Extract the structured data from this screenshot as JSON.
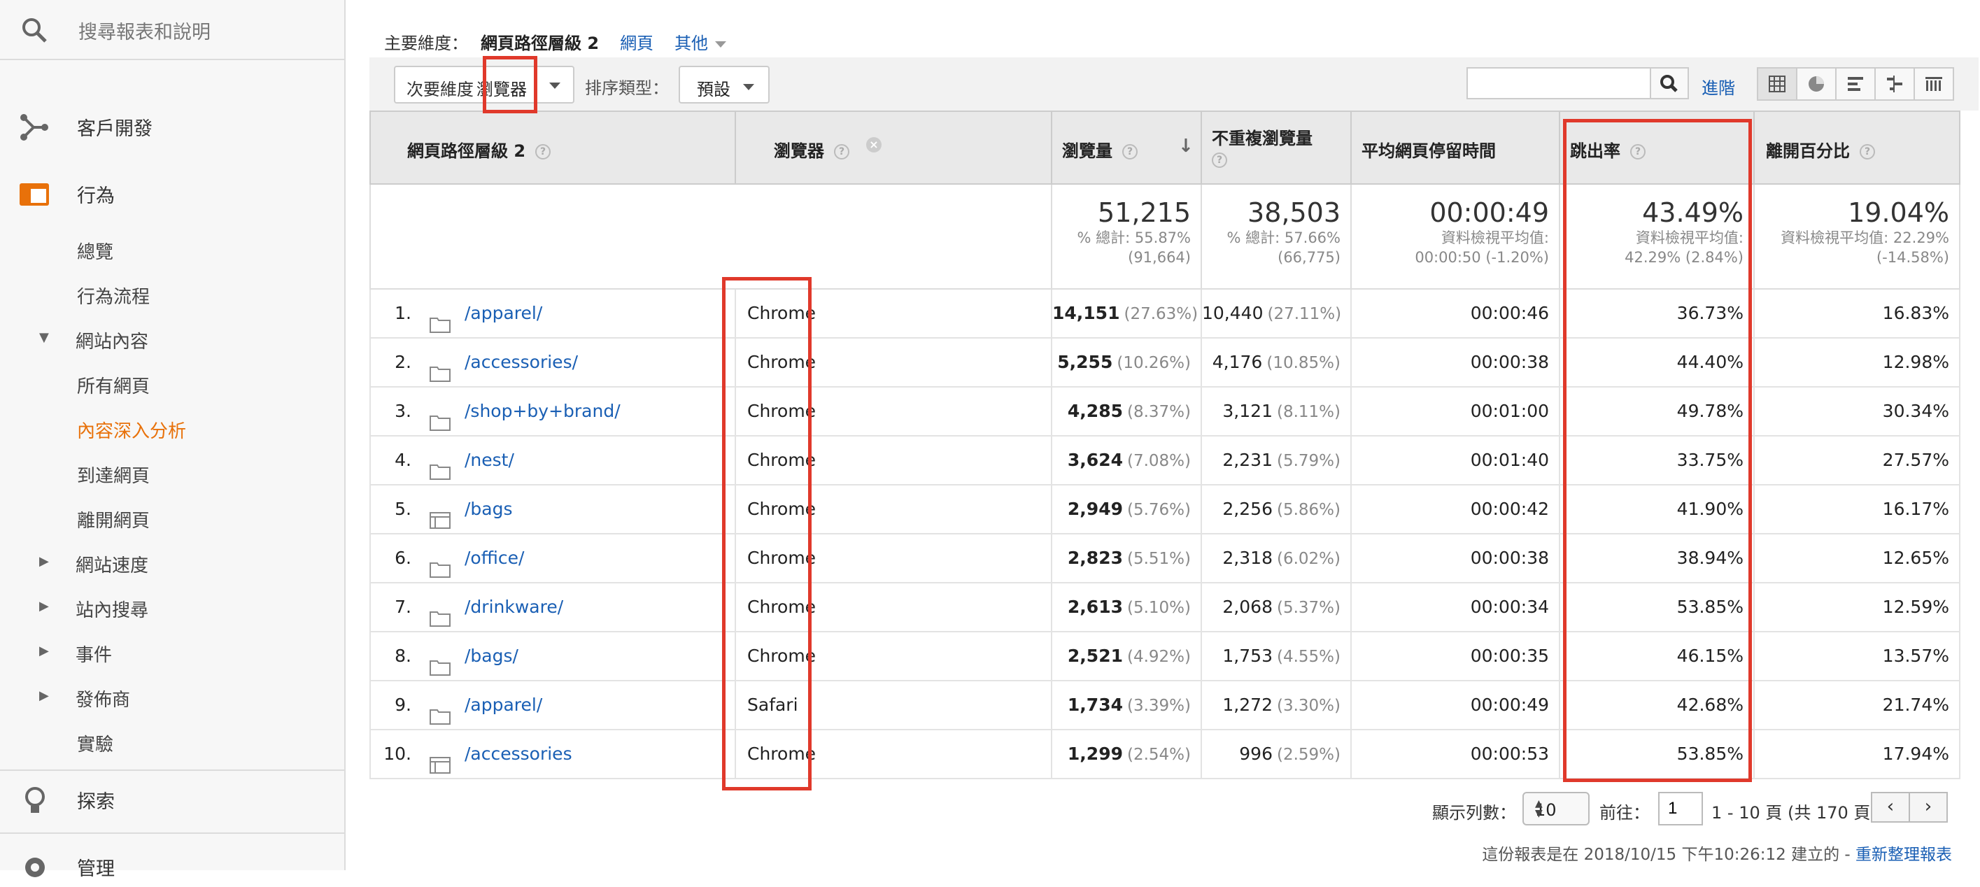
{
  "sidebar": {
    "search_label": "搜尋報表和說明",
    "sections": [
      {
        "label": "客戶開發",
        "icon": "acquisition-icon"
      },
      {
        "label": "行為",
        "icon": "behavior-icon",
        "accent": "#e8710a"
      }
    ],
    "behavior_items": [
      "總覽",
      "行為流程"
    ],
    "site_content": {
      "label": "網站內容",
      "items": [
        "所有網頁",
        "內容深入分析",
        "到達網頁",
        "離開網頁"
      ],
      "active": "內容深入分析"
    },
    "collapsed": [
      "網站速度",
      "站內搜尋",
      "事件",
      "發佈商"
    ],
    "experiments": "實驗",
    "discover": "探索",
    "admin": "管理"
  },
  "primary": {
    "label": "主要維度：",
    "value": "網頁路徑層級 2",
    "link": "網頁",
    "other": "其他"
  },
  "toolbar": {
    "secondary_label": "次要維度",
    "secondary_value": "瀏覽器",
    "sort_label": "排序類型：",
    "sort_value": "預設",
    "search_value": "",
    "advanced": "進階"
  },
  "table": {
    "headers": {
      "path": "網頁路徑層級 2",
      "browser": "瀏覽器",
      "pageviews": "瀏覽量",
      "unique": "不重複瀏覽量",
      "avg_time": "平均網頁停留時間",
      "bounce": "跳出率",
      "exit": "離開百分比"
    },
    "totals": {
      "pageviews": {
        "big": "51,215",
        "l1": "% 總計: 55.87%",
        "l2": "(91,664)"
      },
      "unique": {
        "big": "38,503",
        "l1": "% 總計: 57.66%",
        "l2": "(66,775)"
      },
      "avg_time": {
        "big": "00:00:49",
        "l1": "資料檢視平均值:",
        "l2": "00:00:50 (-1.20%)"
      },
      "bounce": {
        "big": "43.49%",
        "l1": "資料檢視平均值:",
        "l2": "42.29% (2.84%)"
      },
      "exit": {
        "big": "19.04%",
        "l1": "資料檢視平均值: 22.29%",
        "l2": "(-14.58%)"
      }
    },
    "rows": [
      {
        "idx": "1.",
        "icon": "folder-icon",
        "path": "/apparel/",
        "browser": "Chrome",
        "pv": "14,151",
        "pv_pct": "(27.63%)",
        "uv": "10,440",
        "uv_pct": "(27.11%)",
        "time": "00:00:46",
        "bounce": "36.73%",
        "exit": "16.83%"
      },
      {
        "idx": "2.",
        "icon": "folder-icon",
        "path": "/accessories/",
        "browser": "Chrome",
        "pv": "5,255",
        "pv_pct": "(10.26%)",
        "uv": "4,176",
        "uv_pct": "(10.85%)",
        "time": "00:00:38",
        "bounce": "44.40%",
        "exit": "12.98%"
      },
      {
        "idx": "3.",
        "icon": "folder-icon",
        "path": "/shop+by+brand/",
        "browser": "Chrome",
        "pv": "4,285",
        "pv_pct": "(8.37%)",
        "uv": "3,121",
        "uv_pct": "(8.11%)",
        "time": "00:01:00",
        "bounce": "49.78%",
        "exit": "30.34%"
      },
      {
        "idx": "4.",
        "icon": "folder-icon",
        "path": "/nest/",
        "browser": "Chrome",
        "pv": "3,624",
        "pv_pct": "(7.08%)",
        "uv": "2,231",
        "uv_pct": "(5.79%)",
        "time": "00:01:40",
        "bounce": "33.75%",
        "exit": "27.57%"
      },
      {
        "idx": "5.",
        "icon": "page-icon",
        "path": "/bags",
        "browser": "Chrome",
        "pv": "2,949",
        "pv_pct": "(5.76%)",
        "uv": "2,256",
        "uv_pct": "(5.86%)",
        "time": "00:00:42",
        "bounce": "41.90%",
        "exit": "16.17%"
      },
      {
        "idx": "6.",
        "icon": "folder-icon",
        "path": "/office/",
        "browser": "Chrome",
        "pv": "2,823",
        "pv_pct": "(5.51%)",
        "uv": "2,318",
        "uv_pct": "(6.02%)",
        "time": "00:00:38",
        "bounce": "38.94%",
        "exit": "12.65%"
      },
      {
        "idx": "7.",
        "icon": "folder-icon",
        "path": "/drinkware/",
        "browser": "Chrome",
        "pv": "2,613",
        "pv_pct": "(5.10%)",
        "uv": "2,068",
        "uv_pct": "(5.37%)",
        "time": "00:00:34",
        "bounce": "53.85%",
        "exit": "12.59%"
      },
      {
        "idx": "8.",
        "icon": "folder-icon",
        "path": "/bags/",
        "browser": "Chrome",
        "pv": "2,521",
        "pv_pct": "(4.92%)",
        "uv": "1,753",
        "uv_pct": "(4.55%)",
        "time": "00:00:35",
        "bounce": "46.15%",
        "exit": "13.57%"
      },
      {
        "idx": "9.",
        "icon": "folder-icon",
        "path": "/apparel/",
        "browser": "Safari",
        "pv": "1,734",
        "pv_pct": "(3.39%)",
        "uv": "1,272",
        "uv_pct": "(3.30%)",
        "time": "00:00:49",
        "bounce": "42.68%",
        "exit": "21.74%"
      },
      {
        "idx": "10.",
        "icon": "page-icon",
        "path": "/accessories",
        "browser": "Chrome",
        "pv": "1,299",
        "pv_pct": "(2.54%)",
        "uv": "996",
        "uv_pct": "(2.59%)",
        "time": "00:00:53",
        "bounce": "53.85%",
        "exit": "17.94%"
      }
    ]
  },
  "pager": {
    "rows_label": "顯示列數：",
    "rows_value": "10",
    "goto_label": "前往：",
    "goto_value": "1",
    "range": "1 - 10 頁 (共 170 頁)"
  },
  "footer": {
    "text": "這份報表是在 2018/10/15 下午10:26:12 建立的 - ",
    "link": "重新整理報表"
  },
  "colors": {
    "accent": "#e8710a",
    "link": "#1a5fb4",
    "highlight": "#e0392b"
  }
}
